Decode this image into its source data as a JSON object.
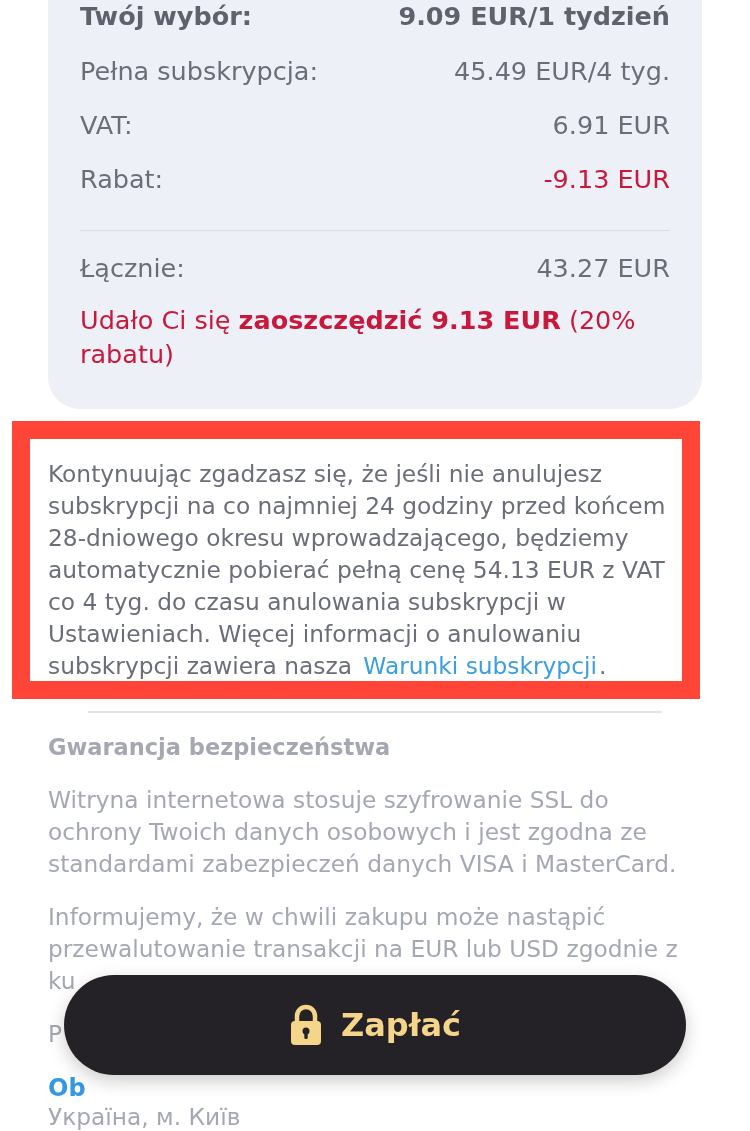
{
  "summary": {
    "rows": [
      {
        "kind": "heading",
        "label": "Twój wybór:",
        "value": "9.09 EUR/1 tydzień"
      },
      {
        "kind": "normal",
        "label": "Pełna subskrypcja:",
        "value": "45.49 EUR/4 tyg."
      },
      {
        "kind": "normal",
        "label": "VAT:",
        "value": "6.91 EUR"
      },
      {
        "kind": "discount",
        "label": "Rabat:",
        "value": "-9.13 EUR"
      }
    ],
    "total": {
      "label": "Łącznie:",
      "value": "43.27 EUR"
    },
    "savings": "Udało Ci się **zaoszczędzić 9.13 EUR** (20% rabatu)"
  },
  "notice": {
    "text": "Kontynuując zgadzasz się, że jeśli nie anulujesz subskrypcji na co najmniej 24 godziny przed końcem 28-dniowego okresu wprowadzającego, będziemy automatycznie pobierać pełną cenę 54.13 EUR z VAT co 4 tyg. do czasu anulowania subskrypcji w Ustawieniach. Więcej informacji o anulowaniu subskrypcji zawiera nasza",
    "link": "Warunki subskrypcji",
    "after": "."
  },
  "security": {
    "title": "Gwarancja bezpieczeństwa",
    "paragraphs": [
      "Witryna internetowa stosuje szyfrowanie SSL do ochrony Twoich danych osobowych i jest zgodna ze standardami zabezpieczeń danych VISA i MasterCard.",
      "Informujemy, że w chwili zakupu może nastąpić przewalutowanie transakcji na EUR lub USD zgodnie z ku"
    ],
    "contact_text": "P",
    "contact_link": "Ob",
    "address": "Україна, м. Київ"
  },
  "pay_button": {
    "label": "Zapłać"
  }
}
